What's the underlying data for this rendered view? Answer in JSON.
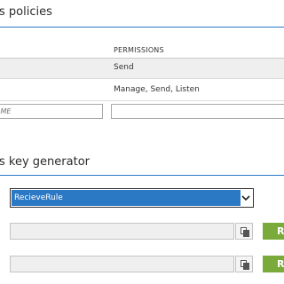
{
  "policies": {
    "title": "s policies",
    "column_header": "PERMISSIONS",
    "rows": [
      {
        "permissions": "Send"
      },
      {
        "permissions": "Manage, Send, Listen"
      }
    ],
    "new_name_placeholder": "AME",
    "new_permissions_value": ""
  },
  "key_generator": {
    "title": "s key generator",
    "selected_policy": "RecieveRule",
    "primary_key_value": "",
    "secondary_key_value": "",
    "regenerate_label": "R"
  },
  "colors": {
    "accent": "#2b78c5",
    "green": "#7aab3a"
  }
}
